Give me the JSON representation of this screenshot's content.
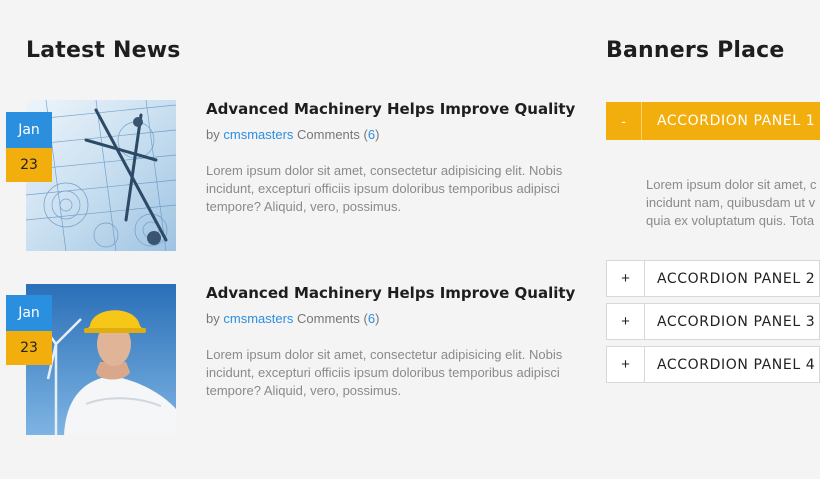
{
  "latest_news": {
    "title": "Latest News",
    "posts": [
      {
        "month": "Jan",
        "day": "23",
        "title": "Advanced Machinery Helps Improve Quality",
        "by": "by",
        "author": "cmsmasters",
        "comments_label": "Comments",
        "comments_open": "(",
        "comments_count": "6",
        "comments_close": ")",
        "excerpt": "Lorem ipsum dolor sit amet, consectetur adipisicing elit. Nobis incidunt, excepturi officiis ipsum doloribus temporibus adipisci tempore? Aliquid, vero, possimus.",
        "thumbnail": "technical-drawing-compass"
      },
      {
        "month": "Jan",
        "day": "23",
        "title": "Advanced Machinery Helps Improve Quality",
        "by": "by",
        "author": "cmsmasters",
        "comments_label": "Comments",
        "comments_open": "(",
        "comments_count": "6",
        "comments_close": ")",
        "excerpt": "Lorem ipsum dolor sit amet, consectetur adipisicing elit. Nobis incidunt, excepturi officiis ipsum doloribus temporibus adipisci tempore? Aliquid, vero, possimus.",
        "thumbnail": "engineer-hard-hat-wind-turbine"
      }
    ]
  },
  "banners": {
    "title": "Banners Place",
    "panels": [
      {
        "toggle": "-",
        "label": "ACCORDION PANEL 1",
        "expanded": true,
        "body_lines": [
          "Lorem ipsum dolor sit amet, c",
          "incidunt nam, quibusdam ut v",
          "quia ex voluptatum quis. Tota"
        ]
      },
      {
        "toggle": "+",
        "label": "ACCORDION PANEL 2",
        "expanded": false
      },
      {
        "toggle": "+",
        "label": "ACCORDION PANEL 3",
        "expanded": false
      },
      {
        "toggle": "+",
        "label": "ACCORDION PANEL 4",
        "expanded": false
      }
    ]
  },
  "colors": {
    "accent_yellow": "#f2ae0c",
    "accent_blue": "#2b8fe0",
    "background": "#f4f4f4"
  }
}
